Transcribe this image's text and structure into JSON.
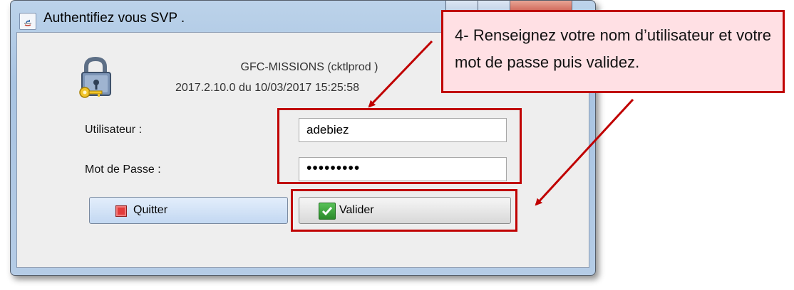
{
  "window": {
    "title": "Authentifiez vous SVP .",
    "app_name": "GFC-MISSIONS (cktlprod )",
    "version_line": "2017.2.10.0 du 10/03/2017 15:25:58"
  },
  "form": {
    "user_label": "Utilisateur :",
    "user_value": "adebiez",
    "password_label": "Mot de Passe :",
    "password_value": "•••••••••"
  },
  "buttons": {
    "quit_label": "Quitter",
    "validate_label": "Valider"
  },
  "callout": {
    "text": "4- Renseignez votre nom d’utilisateur et votre mot de passe puis validez."
  },
  "colors": {
    "annotation": "#c00000",
    "callout_fill": "#ffe0e4"
  }
}
